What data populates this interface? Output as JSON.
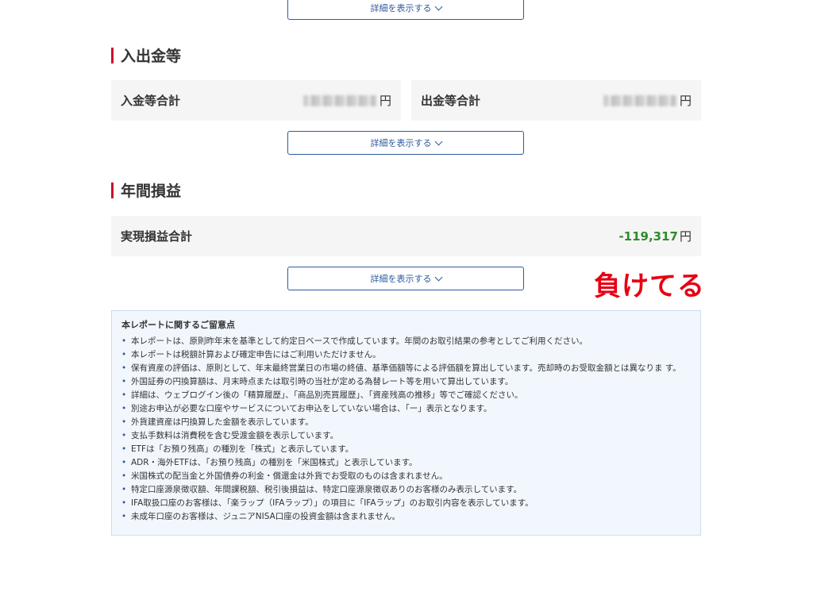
{
  "detail_label": "詳細を表示する",
  "deposits": {
    "title": "入出金等",
    "in_label": "入金等合計",
    "out_label": "出金等合計",
    "currency": "円"
  },
  "annual": {
    "title": "年間損益",
    "realized_label": "実現損益合計",
    "realized_value": "-119,317",
    "currency": "円"
  },
  "annotation": "負けてる",
  "notes": {
    "title": "本レポートに関するご留意点",
    "items": [
      "本レポートは、原則昨年末を基準として約定日ベースで作成しています。年間のお取引結果の参考としてご利用ください。",
      "本レポートは税額計算および確定申告にはご利用いただけません。",
      "保有資産の評価は、原則として、年末最終営業日の市場の終値、基準価額等による評価額を算出しています。売却時のお受取金額とは異なりま す。",
      "外国証券の円換算額は、月末時点または取引時の当社が定める為替レート等を用いて算出しています。",
      "詳細は、ウェブログイン後の「精算履歴」、「商品別売買履歴」、「資産残高の推移」等でご確認ください。",
      "別途お申込が必要な口座やサービスについてお申込をしていない場合は、「ー」表示となります。",
      "外貨建資産は円換算した金額を表示しています。",
      "支払手数料は消費税を含む受渡金額を表示しています。",
      "ETFは「お預り残高」の種別を「株式」と表示しています。",
      "ADR・海外ETFは、「お預り残高」の種別を「米国株式」と表示しています。",
      "米国株式の配当金と外国債券の利金・償還金は外貨でお受取のものは含まれません。",
      "特定口座源泉徴収額、年間課税額、税引後損益は、特定口座源泉徴収ありのお客様のみ表示しています。",
      "IFA取扱口座のお客様は、「楽ラップ（IFAラップ）」の項目に「IFAラップ」のお取引内容を表示しています。",
      "未成年口座のお客様は、ジュニアNISA口座の投資金額は含まれません。"
    ]
  }
}
